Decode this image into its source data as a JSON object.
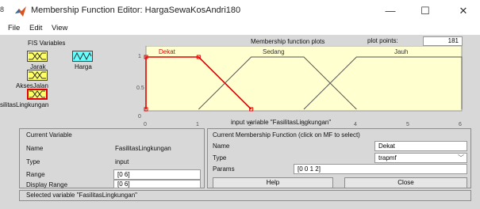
{
  "window": {
    "edge_number": "8",
    "title": "Membership Function Editor: HargaSewaKosAndri180",
    "controls": {
      "minimize": "—",
      "maximize": "☐",
      "close": "✕"
    }
  },
  "menu": {
    "items": [
      "File",
      "Edit",
      "View"
    ]
  },
  "fis_panel": {
    "title": "FIS Variables",
    "variables": [
      {
        "label": "Jarak",
        "kind": "input"
      },
      {
        "label": "Harga",
        "kind": "output"
      },
      {
        "label": "AksesJalan",
        "kind": "input"
      },
      {
        "label": "FasilitasLingkungan",
        "kind": "input",
        "selected": true
      }
    ],
    "visible_labels": [
      "Jarak",
      "Harga",
      "AksesJalan",
      "silitasLingkungan"
    ]
  },
  "plot": {
    "title": "Membership function plots",
    "plot_points_label": "plot points:",
    "plot_points_value": "181",
    "x_axis_label": "input variable \"FasilitasLingkungan\"",
    "y_ticks": [
      "1",
      "0.5",
      "0"
    ],
    "x_ticks": [
      "0",
      "1",
      "2",
      "3",
      "4",
      "5",
      "6"
    ],
    "range": [
      0,
      6
    ],
    "mfs": [
      {
        "name": "Dekat",
        "type": "trapmf",
        "params": [
          0,
          0,
          1,
          2
        ],
        "selected": true
      },
      {
        "name": "Sedang",
        "type": "trapmf",
        "params": [
          1,
          2,
          3,
          4
        ],
        "selected": false
      },
      {
        "name": "Jauh",
        "type": "trapmf",
        "params": [
          3,
          4,
          6,
          6
        ],
        "selected": false
      }
    ]
  },
  "current_variable": {
    "title": "Current Variable",
    "name_label": "Name",
    "name_value": "FasilitasLingkungan",
    "type_label": "Type",
    "type_value": "input",
    "range_label": "Range",
    "range_value": "[0 6]",
    "display_range_label": "Display Range",
    "display_range_value": "[0 6]"
  },
  "current_mf": {
    "title": "Current Membership Function (click on MF to select)",
    "name_label": "Name",
    "name_value": "Dekat",
    "type_label": "Type",
    "type_value": "trapmf",
    "params_label": "Params",
    "params_value": "[0 0 1 2]",
    "help_label": "Help",
    "close_label": "Close"
  },
  "status": "Selected variable \"FasilitasLingkungan\"",
  "colors": {
    "plot_bg": "#ffffd0",
    "selected_mf": "#e00000",
    "mf_line": "#555555",
    "input_box": "#ffff66",
    "output_box": "#66ffff"
  }
}
